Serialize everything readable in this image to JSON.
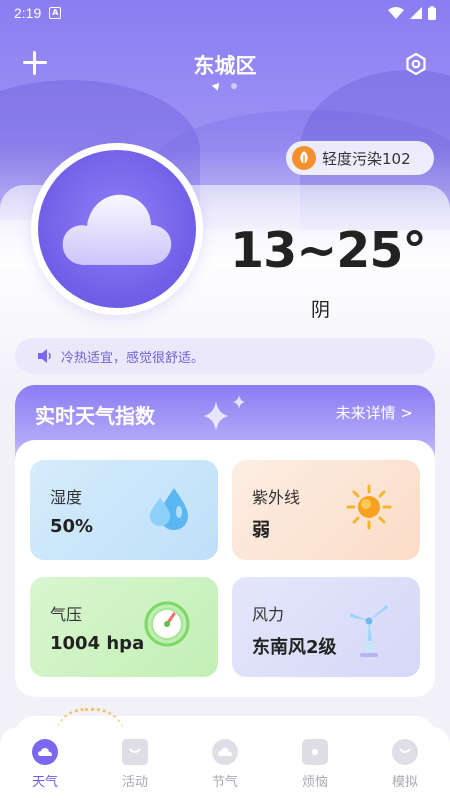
{
  "status_bar": {
    "time": "2:19",
    "notif_glyph": "A"
  },
  "header": {
    "city": "东城区"
  },
  "air_quality": {
    "label": "轻度污染102",
    "icon": "leaf-icon",
    "color": "#f3902d"
  },
  "weather": {
    "temp_range": "13~25°",
    "condition": "阴",
    "icon": "cloud-icon"
  },
  "tip": {
    "text": "冷热适宜，感觉很舒适。"
  },
  "index_section": {
    "title": "实时天气指数",
    "more": "未来详情 >",
    "tiles": [
      {
        "label": "湿度",
        "value": "50%",
        "icon": "water-drops-icon"
      },
      {
        "label": "紫外线",
        "value": "弱",
        "icon": "sun-icon"
      },
      {
        "label": "气压",
        "value": "1004 hpa",
        "icon": "gauge-icon"
      },
      {
        "label": "风力",
        "value": "东南风2级",
        "icon": "wind-turbine-icon"
      }
    ]
  },
  "tabs": [
    {
      "label": "天气",
      "active": true
    },
    {
      "label": "活动",
      "active": false
    },
    {
      "label": "节气",
      "active": false
    },
    {
      "label": "烦恼",
      "active": false
    },
    {
      "label": "模拟",
      "active": false
    }
  ],
  "colors": {
    "primary": "#7a68ee",
    "accent_orange": "#f3902d"
  }
}
